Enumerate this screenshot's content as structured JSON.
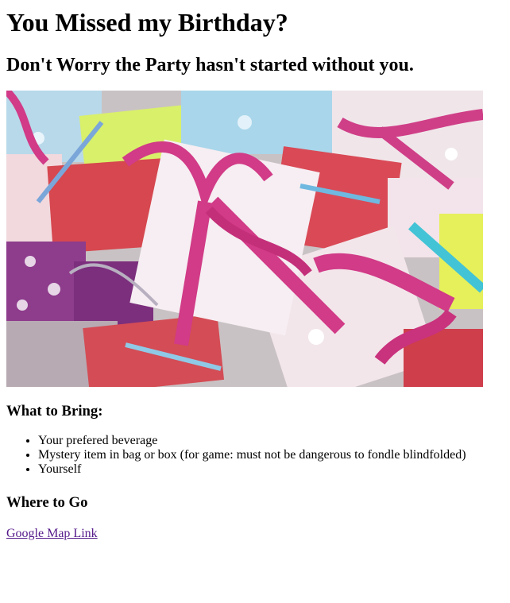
{
  "page": {
    "title": "You Missed my Birthday?",
    "subtitle": "Don't Worry the Party hasn't started without you."
  },
  "bring": {
    "heading": "What to Bring:",
    "items": [
      "Your prefered beverage",
      "Mystery item in bag or box (for game: must not be dangerous to fondle blindfolded)",
      "Yourself"
    ]
  },
  "where": {
    "heading": "Where to Go",
    "link_label": "Google Map Link"
  },
  "colors": {
    "link": "#551a8b",
    "ribbon": "#d13b87"
  }
}
